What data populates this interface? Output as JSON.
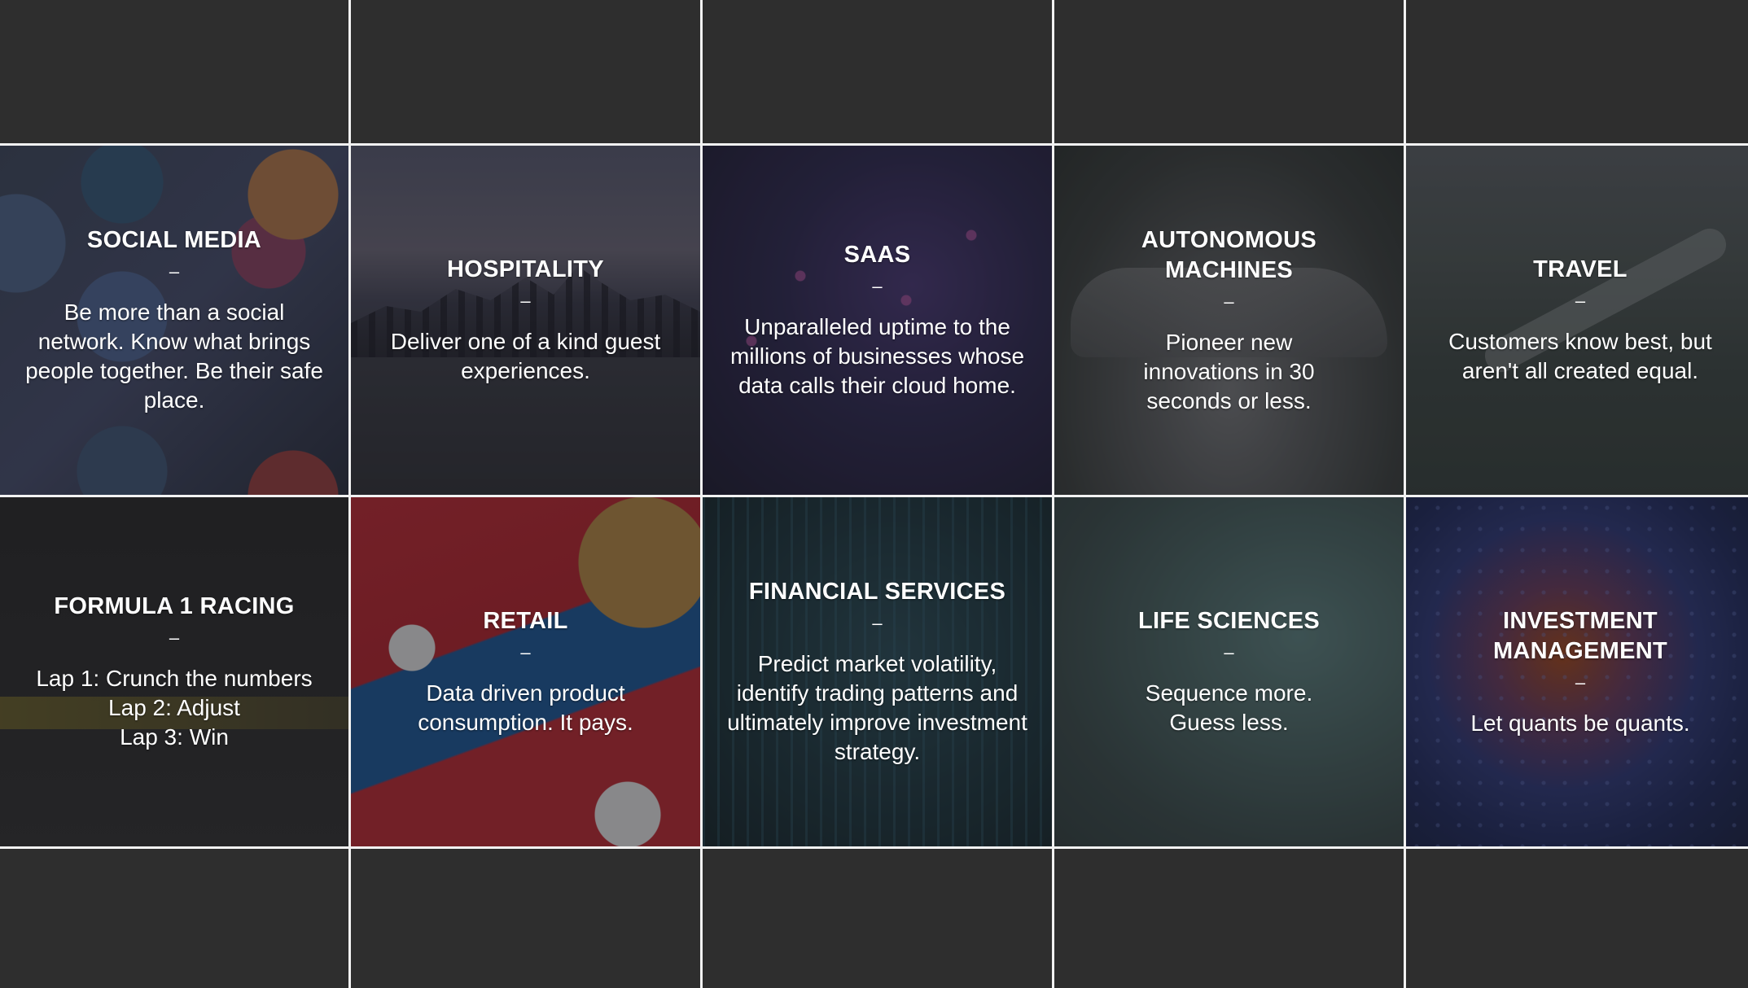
{
  "tiles": [
    {
      "title": "SOCIAL MEDIA",
      "dash": "–",
      "body": "Be more than a social network. Know what brings people together. Be their safe place."
    },
    {
      "title": "HOSPITALITY",
      "dash": "–",
      "body": "Deliver one of a kind guest experiences."
    },
    {
      "title": "SAAS",
      "dash": "–",
      "body": "Unparalleled uptime to the millions of businesses whose data calls their cloud home."
    },
    {
      "title": "AUTONOMOUS MACHINES",
      "dash": "–",
      "body": "Pioneer new innovations in 30 seconds or less."
    },
    {
      "title": "TRAVEL",
      "dash": "–",
      "body": "Customers know best, but aren't all created equal."
    },
    {
      "title": "FORMULA 1 RACING",
      "dash": "–",
      "body_lines": [
        "Lap 1: Crunch the numbers",
        "Lap 2: Adjust",
        "Lap 3: Win"
      ]
    },
    {
      "title": "RETAIL",
      "dash": "–",
      "body": "Data driven product consumption. It pays."
    },
    {
      "title": "FINANCIAL SERVICES",
      "dash": "–",
      "body": "Predict market volatility, identify trading patterns and ultimately improve investment strategy."
    },
    {
      "title": "LIFE SCIENCES",
      "dash": "–",
      "body": "Sequence more. Guess less."
    },
    {
      "title": "INVESTMENT MANAGEMENT",
      "dash": "–",
      "body": "Let quants be quants."
    }
  ]
}
